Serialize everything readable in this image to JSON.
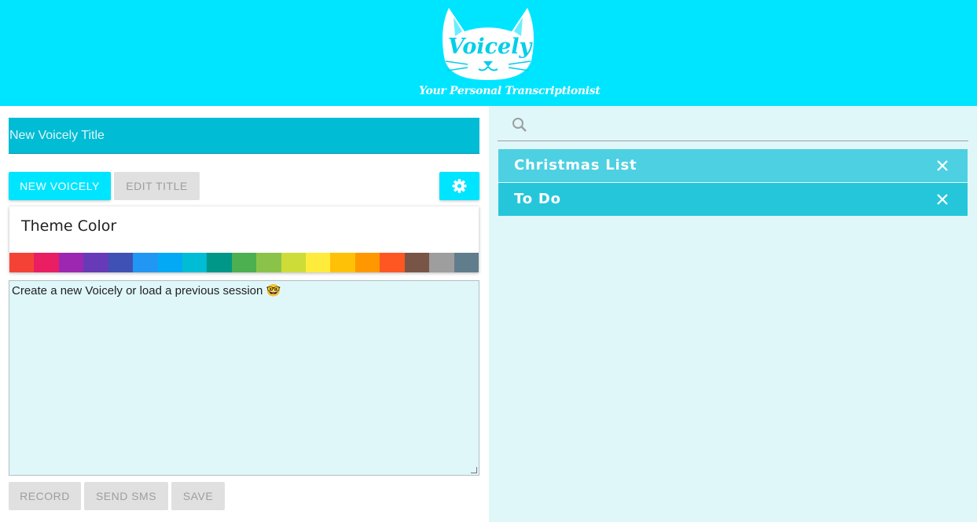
{
  "header": {
    "logo_text": "Voicely",
    "tagline": "Your Personal Transcriptionist",
    "background": "#00e5ff"
  },
  "editor": {
    "title_placeholder": "New Voicely Title",
    "new_button": "NEW VOICELY",
    "edit_title_button": "EDIT TITLE",
    "settings_icon": "gear-icon",
    "theme": {
      "label": "Theme Color",
      "colors": [
        "#f44336",
        "#e91e63",
        "#9c27b0",
        "#673ab7",
        "#3f51b5",
        "#2196f3",
        "#03a9f4",
        "#00bcd4",
        "#009688",
        "#4caf50",
        "#8bc34a",
        "#cddc39",
        "#ffeb3b",
        "#ffc107",
        "#ff9800",
        "#ff5722",
        "#795548",
        "#9e9e9e",
        "#607d8b"
      ]
    },
    "body_text": "Create a new Voicely or load a previous session 🤓",
    "record_button": "RECORD",
    "send_sms_button": "SEND SMS",
    "save_button": "SAVE"
  },
  "sidebar": {
    "search_icon": "search-icon",
    "search_placeholder": "",
    "items": [
      {
        "label": "Christmas List",
        "color": "#4dd0e1"
      },
      {
        "label": "To Do",
        "color": "#26c6da"
      }
    ]
  }
}
